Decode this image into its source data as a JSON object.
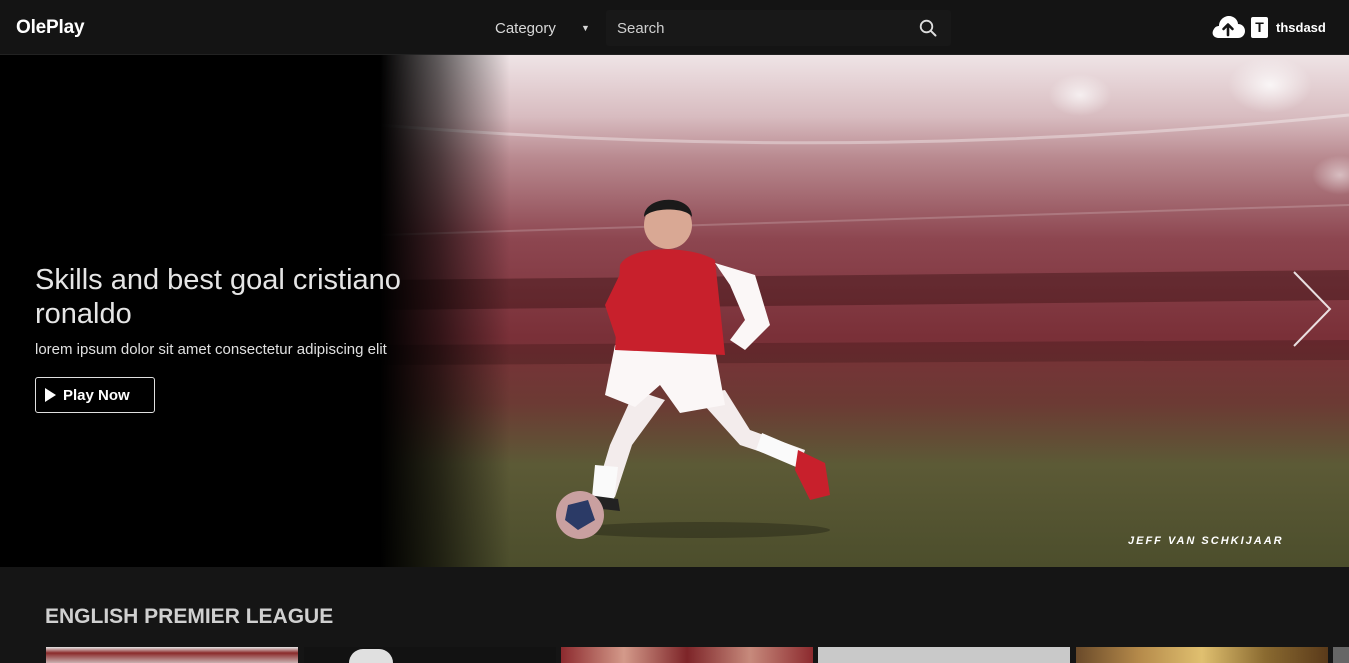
{
  "navbar": {
    "brand": "OlePlay",
    "category_label": "Category",
    "caret": "▼",
    "search_placeholder": "Search",
    "search_value": "",
    "upload_icon": "cloud-upload-icon",
    "avatar_letter": "T",
    "username": "thsdasd"
  },
  "hero": {
    "title": "Skills and best goal cristiano ronaldo",
    "subtitle": "lorem ipsum dolor sit amet consectetur adipiscing elit",
    "play_label": "Play Now",
    "watermark": "JEFF VAN SCHKIJAAR",
    "next_icon": "chevron-right-icon"
  },
  "section": {
    "title": "ENGLISH PREMIER LEAGUE"
  },
  "colors": {
    "background": "#151515",
    "navbar": "#141414",
    "hero_text": "#e5e5e5",
    "jersey_red": "#c8202c"
  }
}
